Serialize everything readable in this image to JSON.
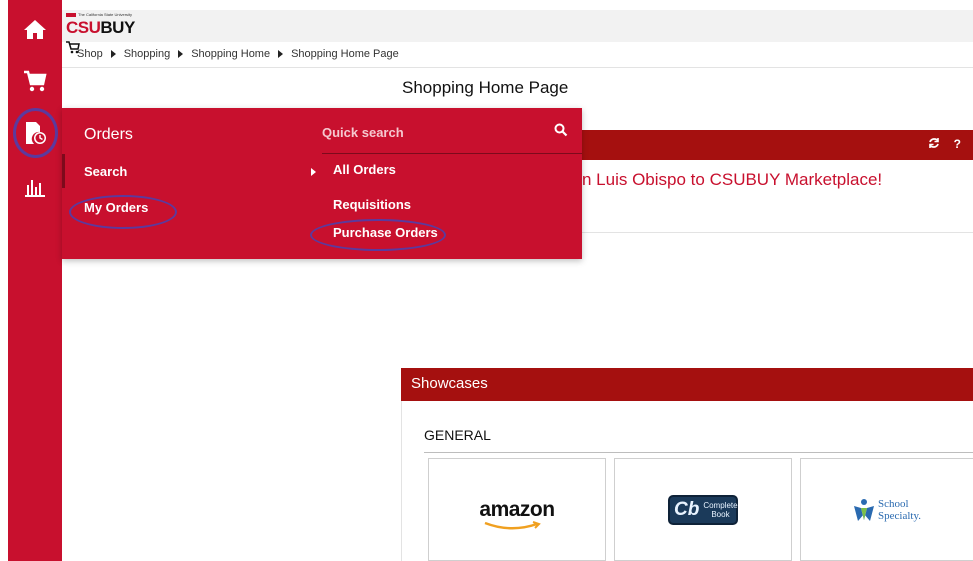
{
  "rail": {
    "items": [
      {
        "name": "home",
        "icon": "home-icon"
      },
      {
        "name": "shop",
        "icon": "cart-icon"
      },
      {
        "name": "orders",
        "icon": "document-clock-icon",
        "active": true
      },
      {
        "name": "reports",
        "icon": "bar-chart-icon"
      }
    ]
  },
  "header": {
    "logo_tagline": "The California State University",
    "logo_csu": "CSU",
    "logo_buy": "BUY"
  },
  "breadcrumb": [
    "Shop",
    "Shopping",
    "Shopping Home",
    "Shopping Home Page"
  ],
  "page_title": "Shopping Home Page",
  "welcome_panel": {
    "message": "n Luis Obispo to CSUBUY Marketplace!",
    "refresh_icon": "refresh-icon",
    "help_label": "?"
  },
  "orders_flyout": {
    "title": "Orders",
    "menu": [
      {
        "label": "Search",
        "has_submenu": true
      },
      {
        "label": "My Orders",
        "highlighted": true
      }
    ],
    "quick_search_placeholder": "Quick search",
    "submenu": [
      {
        "label": "All Orders"
      },
      {
        "label": "Requisitions"
      },
      {
        "label": "Purchase Orders",
        "highlighted": true
      }
    ]
  },
  "showcases": {
    "title": "Showcases",
    "section": "GENERAL",
    "tiles": [
      {
        "name": "amazon",
        "label": "amazon"
      },
      {
        "name": "complete-book",
        "mark": "Cb",
        "label_line1": "Complete",
        "label_line2": "Book"
      },
      {
        "name": "school-specialty",
        "label_line1": "School",
        "label_line2": "Specialty."
      }
    ]
  },
  "colors": {
    "brand_red": "#c8102e",
    "header_dark_red": "#a5100f",
    "highlight_ring": "#5b3a9e"
  }
}
